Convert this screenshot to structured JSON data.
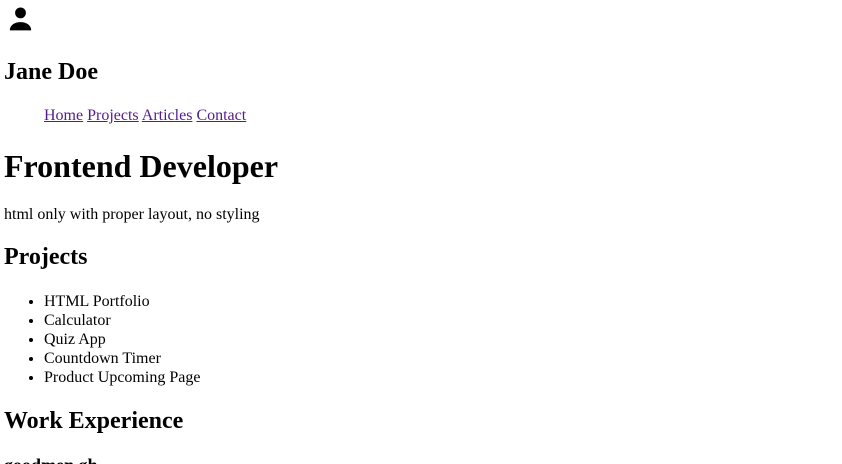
{
  "profile": {
    "avatar_icon": "user-icon",
    "name": "Jane Doe"
  },
  "nav": {
    "items": [
      "Home",
      "Projects",
      "Articles",
      "Contact"
    ],
    "link_color": "#551a8b"
  },
  "hero": {
    "title": "Frontend Developer",
    "tagline": "html only with proper layout, no styling"
  },
  "projects": {
    "heading": "Projects",
    "items": [
      "HTML Portfolio",
      "Calculator",
      "Quiz App",
      "Countdown Timer",
      "Product Upcoming Page"
    ]
  },
  "work": {
    "heading": "Work Experience",
    "company": "goodmen.gh"
  }
}
